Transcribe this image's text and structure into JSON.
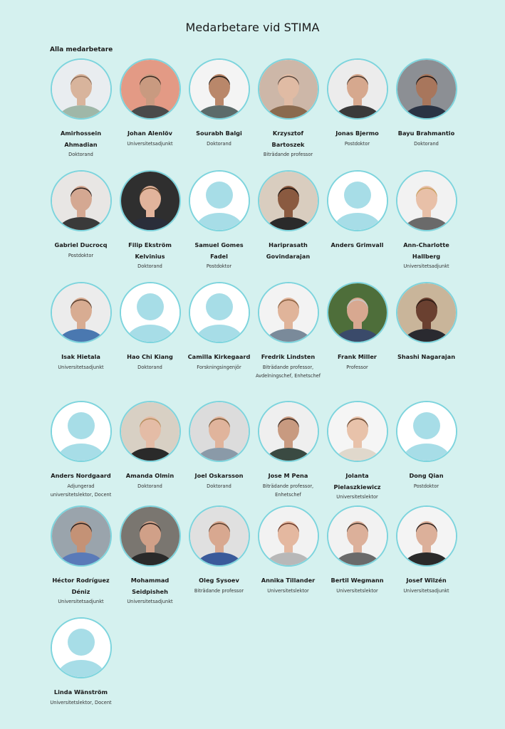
{
  "page": {
    "title": "Medarbetare vid STIMA",
    "section_heading": "Alla medarbetare"
  },
  "colors": {
    "background": "#d5f1ef",
    "avatar_border": "#7dd4dd",
    "placeholder_silhouette": "#a7dde7"
  },
  "people": [
    {
      "name": "Amirhossein Ahmadian",
      "role": "Doktorand",
      "photo": true,
      "bg": "#e9edf0",
      "skin": "#d8b49c",
      "hair": "#8a6a55",
      "shirt": "#9fb7a8"
    },
    {
      "name": "Johan Alenlöv",
      "role": "Universitetsadjunkt",
      "photo": true,
      "bg": "#e39a85",
      "skin": "#c99a80",
      "hair": "#3a2a22",
      "shirt": "#4a4a4a"
    },
    {
      "name": "Sourabh Balgi",
      "role": "Doktorand",
      "photo": true,
      "bg": "#f4f4f4",
      "skin": "#b9876a",
      "hair": "#1e1a18",
      "shirt": "#5c6b6a"
    },
    {
      "name": "Krzysztof Bartoszek",
      "role": "Biträdande professor",
      "photo": true,
      "bg": "#cdb7a8",
      "skin": "#e0bba4",
      "hair": "#5a4a40",
      "shirt": "#8a6a4e"
    },
    {
      "name": "Jonas Bjermo",
      "role": "Postdoktor",
      "photo": true,
      "bg": "#ececec",
      "skin": "#d6a88e",
      "hair": "#4a3a30",
      "shirt": "#3a3a3a"
    },
    {
      "name": "Bayu Brahmantio",
      "role": "Doktorand",
      "photo": true,
      "bg": "#8c8f94",
      "skin": "#a8765c",
      "hair": "#1a1616",
      "shirt": "#2a3344"
    },
    {
      "name": "Gabriel Ducrocq",
      "role": "Postdoktor",
      "photo": true,
      "bg": "#e8e6e4",
      "skin": "#d4a892",
      "hair": "#2a2220",
      "shirt": "#3a3a3a"
    },
    {
      "name": "Filip Ekström Kelvinius",
      "role": "Doktorand",
      "photo": true,
      "bg": "#2f2f2f",
      "skin": "#e2b49c",
      "hair": "#6a4a30",
      "shirt": "#2a2e3a"
    },
    {
      "name": "Samuel Gomes Fadel",
      "role": "Postdoktor",
      "photo": false
    },
    {
      "name": "Hariprasath Govindarajan",
      "role": "",
      "photo": true,
      "bg": "#d9cdbf",
      "skin": "#8a5a40",
      "hair": "#1a1412",
      "shirt": "#2a2a2a"
    },
    {
      "name": "Anders Grimvall",
      "role": "",
      "photo": false
    },
    {
      "name": "Ann-Charlotte Hallberg",
      "role": "Universitetsadjunkt",
      "photo": true,
      "bg": "#f2f2f2",
      "skin": "#e8c0a8",
      "hair": "#c8a060",
      "shirt": "#6a6a6a"
    },
    {
      "name": "Isak Hietala",
      "role": "Universitetsadjunkt",
      "photo": true,
      "bg": "#ececec",
      "skin": "#d8ac92",
      "hair": "#5a4030",
      "shirt": "#4a78b0"
    },
    {
      "name": "Hao Chi Kiang",
      "role": "Doktorand",
      "photo": false
    },
    {
      "name": "Camilla Kirkegaard",
      "role": "Forskningsingenjör",
      "photo": false
    },
    {
      "name": "Fredrik Lindsten",
      "role": "Biträdande professor, Avdelningschef, Enhetschef",
      "photo": true,
      "bg": "#f3f3f3",
      "skin": "#e0b49a",
      "hair": "#8a6040",
      "shirt": "#7a8a9a"
    },
    {
      "name": "Frank Miller",
      "role": "Professor",
      "photo": true,
      "bg": "#4e6e3a",
      "skin": "#d8a890",
      "hair": "#c8c8c8",
      "shirt": "#3a4a6a"
    },
    {
      "name": "Shashi Nagarajan",
      "role": "",
      "photo": true,
      "bg": "#c9b59a",
      "skin": "#6a4030",
      "hair": "#2a1a14",
      "shirt": "#2a2a30"
    },
    {
      "name": "Anders Nordgaard",
      "role": "Adjungerad universitetslektor, Docent",
      "photo": false
    },
    {
      "name": "Amanda Olmin",
      "role": "Doktorand",
      "photo": true,
      "bg": "#d8d0c4",
      "skin": "#e4bca6",
      "hair": "#b89060",
      "shirt": "#2a2a2a"
    },
    {
      "name": "Joel Oskarsson",
      "role": "Doktorand",
      "photo": true,
      "bg": "#dcdcdc",
      "skin": "#e0b49c",
      "hair": "#7a5a3a",
      "shirt": "#8a9aa8"
    },
    {
      "name": "Jose M Pena",
      "role": "Biträdande professor, Enhetschef",
      "photo": true,
      "bg": "#efefef",
      "skin": "#c89a80",
      "hair": "#3a2a22",
      "shirt": "#3a4a42"
    },
    {
      "name": "Jolanta Pielaszkiewicz",
      "role": "Universitetslektor",
      "photo": true,
      "bg": "#f5f5f5",
      "skin": "#e8c2aa",
      "hair": "#6a4a34",
      "shirt": "#e0d8cc"
    },
    {
      "name": "Dong Qian",
      "role": "Postdoktor",
      "photo": false
    },
    {
      "name": "Héctor Rodríguez Déniz",
      "role": "Universitetsadjunkt",
      "photo": true,
      "bg": "#9aa4ac",
      "skin": "#c49276",
      "hair": "#2a2220",
      "shirt": "#5a7ab8"
    },
    {
      "name": "Mohammad Seidpisheh",
      "role": "Universitetsadjunkt",
      "photo": true,
      "bg": "#7a7670",
      "skin": "#d0a088",
      "hair": "#2a2220",
      "shirt": "#2a2a2a"
    },
    {
      "name": "Oleg Sysoev",
      "role": "Biträdande professor",
      "photo": true,
      "bg": "#e0e0e0",
      "skin": "#d8a890",
      "hair": "#5a4030",
      "shirt": "#3a5a9a"
    },
    {
      "name": "Annika Tillander",
      "role": "Universitetslektor",
      "photo": true,
      "bg": "#f2f2f2",
      "skin": "#e4b8a0",
      "hair": "#6a3a2a",
      "shirt": "#b8b8b8"
    },
    {
      "name": "Bertil Wegmann",
      "role": "Universitetslektor",
      "photo": true,
      "bg": "#f2f2f2",
      "skin": "#dcb09a",
      "hair": "#4a3a30",
      "shirt": "#6a6a6a"
    },
    {
      "name": "Josef Wilzén",
      "role": "Universitetsadjunkt",
      "photo": true,
      "bg": "#f4f4f4",
      "skin": "#dcb09a",
      "hair": "#2a2220",
      "shirt": "#2a2a2a"
    },
    {
      "name": "Linda Wänström",
      "role": "Universitetslektor, Docent",
      "photo": false
    }
  ]
}
